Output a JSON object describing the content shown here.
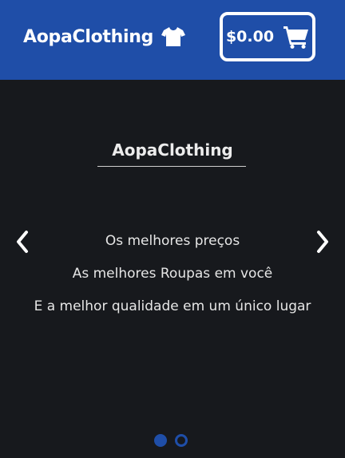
{
  "header": {
    "brand_name": "AopaClothing",
    "brand_icon": "tshirt-icon",
    "cart_total": "$0.00",
    "cart_icon": "shopping-cart-icon",
    "background_color": "#1f4ea8"
  },
  "hero": {
    "title": "AopaClothing",
    "lines": [
      "Os melhores preços",
      "As melhores Roupas em você",
      "E a melhor qualidade em um único lugar"
    ],
    "prev_icon": "chevron-left-icon",
    "next_icon": "chevron-right-icon"
  },
  "carousel": {
    "slide_count": 2,
    "active_index": 0
  }
}
